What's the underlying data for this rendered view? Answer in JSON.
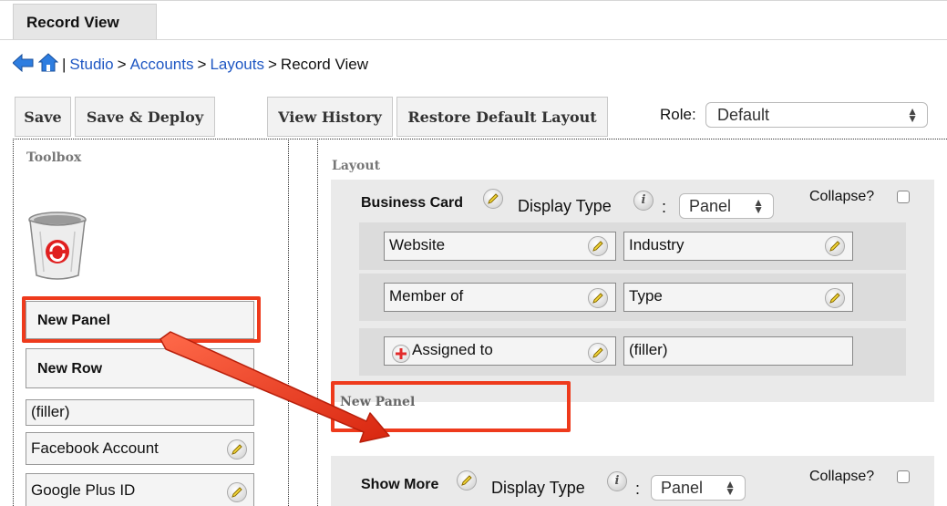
{
  "tab": {
    "label": "Record View"
  },
  "breadcrumb": {
    "separator": "|",
    "studio": "Studio",
    "accounts": "Accounts",
    "layouts": "Layouts",
    "current": "Record View",
    "gt": ">"
  },
  "toolbar": {
    "save": "Save",
    "save_deploy": "Save & Deploy",
    "view_history": "View History",
    "restore_default": "Restore Default Layout",
    "role_label": "Role:",
    "role_value": "Default"
  },
  "toolbox": {
    "heading": "Toolbox",
    "items": {
      "new_panel": "New Panel",
      "new_row": "New Row",
      "filler": "(filler)",
      "facebook": "Facebook Account",
      "google_plus": "Google Plus ID"
    }
  },
  "layout": {
    "heading": "Layout",
    "business_card": {
      "title": "Business Card",
      "display_type_label": "Display Type",
      "colon": ":",
      "display_type_value": "Panel",
      "collapse_label": "Collapse?",
      "rows": [
        {
          "left": "Website",
          "right": "Industry"
        },
        {
          "left": "Member of",
          "right": "Type"
        },
        {
          "left": "Assigned to",
          "right": "(filler)"
        }
      ]
    },
    "new_panel_drop": "New Panel",
    "show_more": {
      "title": "Show More",
      "display_type_label": "Display Type",
      "colon": ":",
      "display_type_value": "Panel",
      "collapse_label": "Collapse?"
    }
  },
  "colors": {
    "link": "#1f57c3",
    "highlight": "#ee3a1c",
    "panel_bg": "#eaeaea"
  },
  "icons": [
    "back-arrow-icon",
    "home-icon",
    "trash-icon",
    "pencil-icon",
    "info-icon",
    "plus-icon",
    "drag-arrow"
  ]
}
